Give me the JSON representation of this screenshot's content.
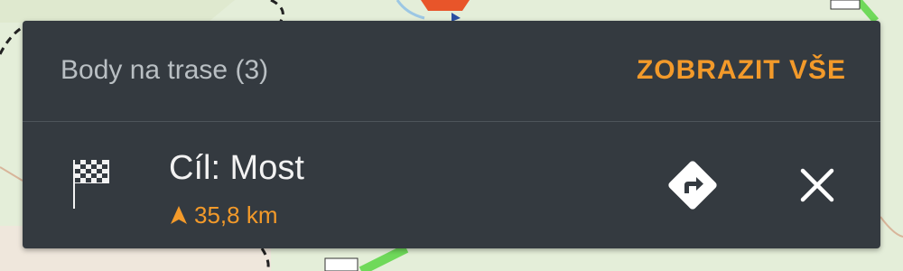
{
  "panel": {
    "title": "Body na trase (3)",
    "show_all_label": "ZOBRAZIT VŠE"
  },
  "waypoint": {
    "name": "Cíl: Most",
    "distance": "35,8 km",
    "icon": "checkered-flag-icon",
    "direction_icon": "arrow-up-icon"
  },
  "actions": {
    "navigate_icon": "turn-right-diamond-icon",
    "close_icon": "close-icon"
  },
  "colors": {
    "accent": "#f39a2a",
    "panel_bg": "#343a40",
    "title": "#b9bfc3",
    "name": "#f2f2f2"
  }
}
